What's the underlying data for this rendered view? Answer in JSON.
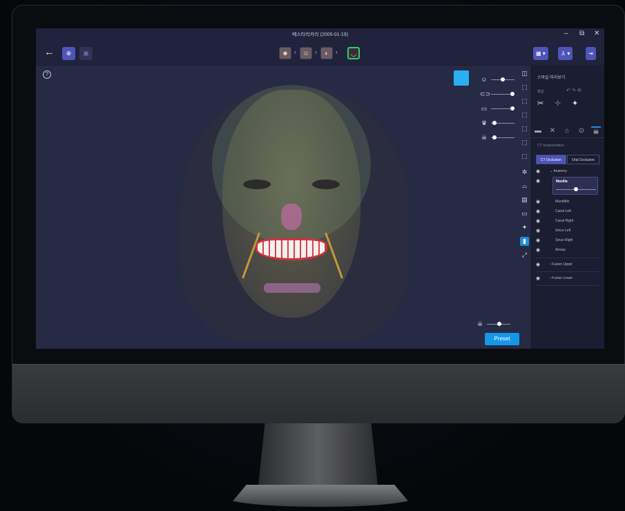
{
  "window": {
    "title": "메스타리카리 (2005-01-19)",
    "controls": [
      "–",
      "⧉",
      "✕"
    ]
  },
  "toolbar": {
    "back_icon": "←",
    "workflow_steps": [
      {
        "name": "ct-step",
        "active": false
      },
      {
        "name": "face-scan-step",
        "active": false
      },
      {
        "name": "profile-step",
        "active": false
      },
      {
        "name": "teeth-step",
        "active": true
      }
    ],
    "right_buttons": [
      "layout-menu",
      "user-menu",
      "exit"
    ]
  },
  "viewport": {
    "help_label": "?",
    "accent_color": "#2ab0f2",
    "opacity_sliders": [
      {
        "icon": "face-icon",
        "value": 0.55
      },
      {
        "icon": "upper-jaw-icon",
        "value": 0.95
      },
      {
        "icon": "lower-jaw-icon",
        "value": 0.95
      },
      {
        "icon": "crown-icon",
        "value": 0.1
      },
      {
        "icon": "skull-icon",
        "value": 0.1
      }
    ],
    "bottom_slider": {
      "icon": "skull-icon",
      "value": 0.5
    },
    "preset_label": "Preset"
  },
  "panel": {
    "title": "스마일 미리보기",
    "edit_label": "편집",
    "segmentation_title": "CT Segmentation",
    "segments": [
      {
        "label": "CT Occlusion",
        "active": true
      },
      {
        "label": "Oral Occlusion",
        "active": false
      }
    ],
    "anatomy_label": "Anatomy",
    "selected_item": "Maxilla",
    "items": [
      "Mandible",
      "Canal Left",
      "Canal Right",
      "Sinus Left",
      "Sinus Right",
      "Airway"
    ],
    "groups": [
      "Fusion Upper",
      "Fusion Lower"
    ]
  }
}
